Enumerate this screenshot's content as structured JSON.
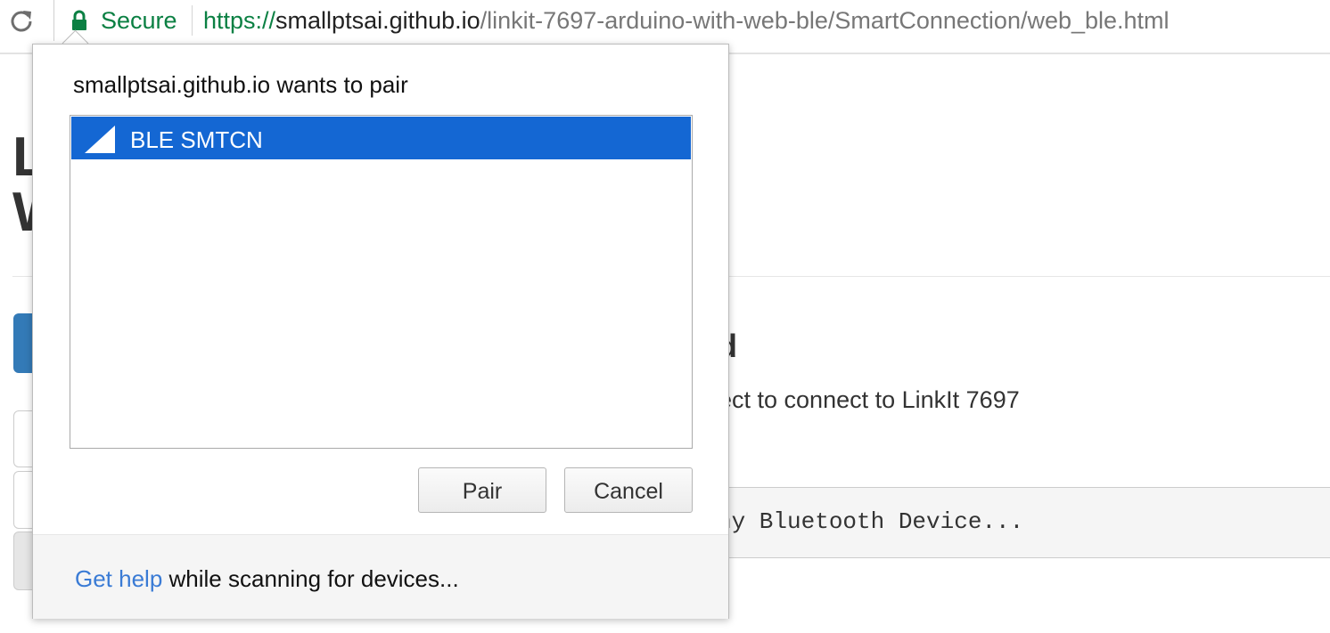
{
  "toolbar": {
    "secure_label": "Secure",
    "url_scheme": "https://",
    "url_host": "smallptsai.github.io",
    "url_path": "/linkit-7697-arduino-with-web-ble/SmartConnection/web_ble.html"
  },
  "page": {
    "heading_line1": "L",
    "heading_line2": "W",
    "section_title": "d",
    "section_text": "ect to connect to LinkIt 7697",
    "code_text": "ny Bluetooth Device..."
  },
  "dialog": {
    "title": "smallptsai.github.io wants to pair",
    "devices": [
      {
        "name": "BLE SMTCN",
        "selected": true,
        "icon": "signal-strength-icon"
      }
    ],
    "pair_label": "Pair",
    "cancel_label": "Cancel",
    "help_link": "Get help",
    "footer_text": " while scanning for devices..."
  },
  "colors": {
    "secure_green": "#0b8043",
    "selection_blue": "#1467d3",
    "link_blue": "#3a7bd5"
  }
}
